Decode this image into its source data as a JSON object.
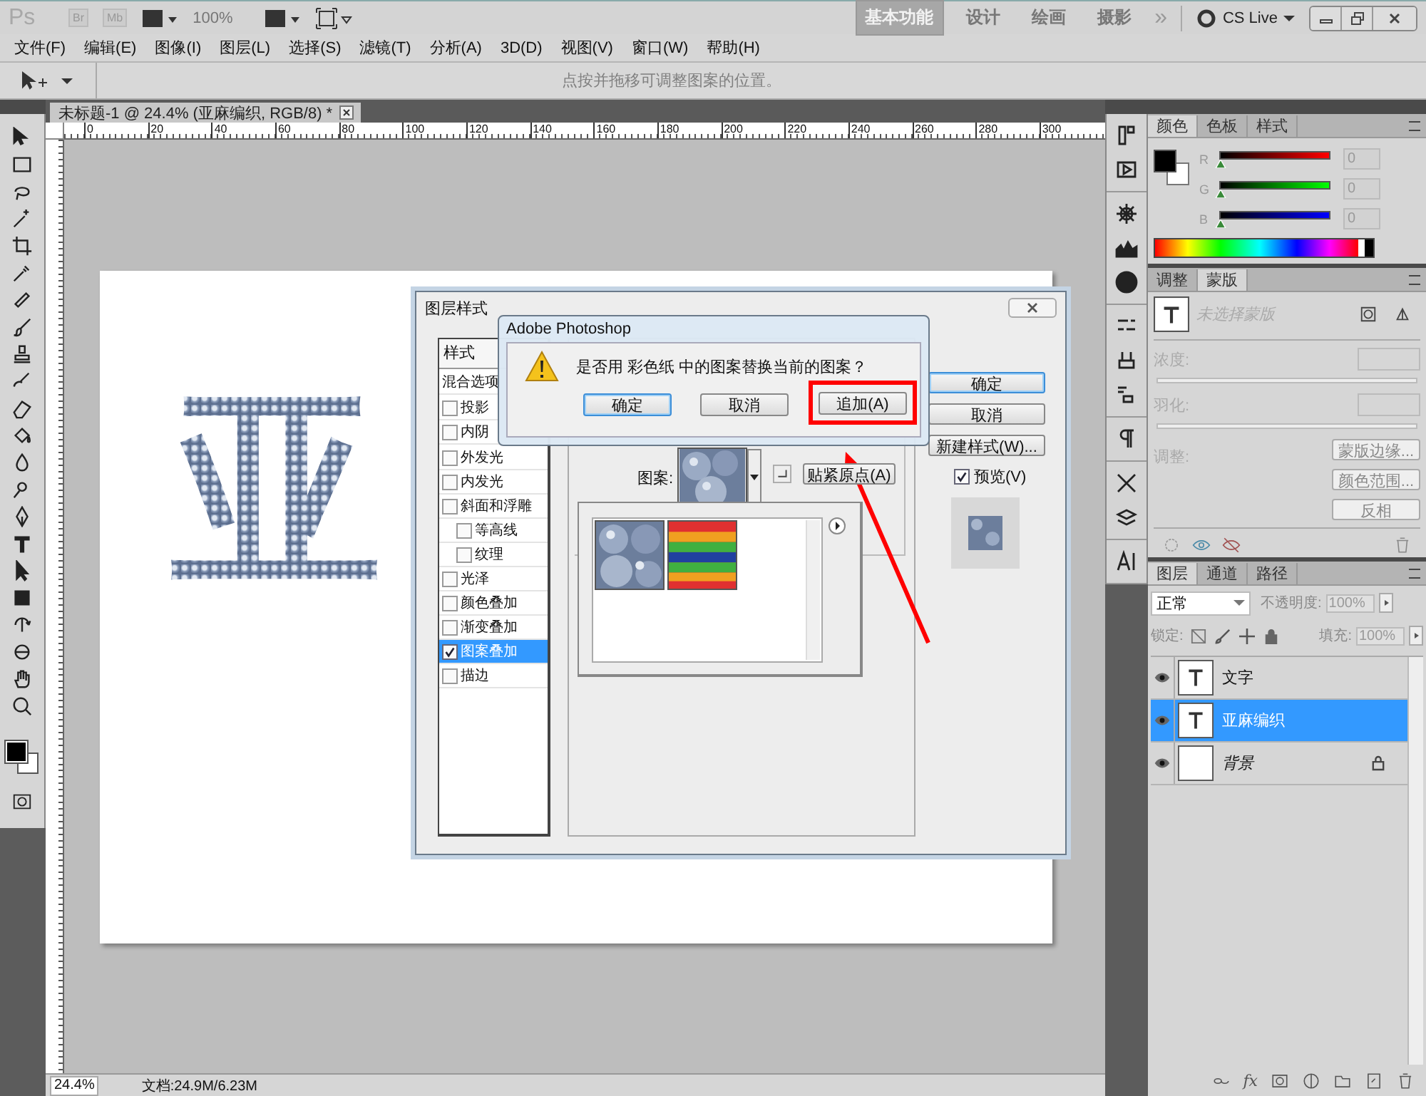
{
  "app_bar": {
    "logo": "Ps",
    "bridge": "Br",
    "mini_bridge": "Mb",
    "zoom": "100%",
    "workspaces": [
      {
        "label": "基本功能",
        "selected": true
      },
      {
        "label": "设计",
        "selected": false
      },
      {
        "label": "绘画",
        "selected": false
      },
      {
        "label": "摄影",
        "selected": false
      }
    ],
    "more": "»",
    "cs_live": "CS Live"
  },
  "menu": [
    "文件(F)",
    "编辑(E)",
    "图像(I)",
    "图层(L)",
    "选择(S)",
    "滤镜(T)",
    "分析(A)",
    "3D(D)",
    "视图(V)",
    "窗口(W)",
    "帮助(H)"
  ],
  "options_bar": {
    "hint": "点按并拖移可调整图案的位置。"
  },
  "document": {
    "tab": "未标题-1 @ 24.4% (亚麻编织, RGB/8) *",
    "ruler": [
      "0",
      "20",
      "40",
      "60",
      "80",
      "100",
      "120",
      "140",
      "160",
      "180",
      "200",
      "220",
      "240",
      "260",
      "280",
      "300"
    ],
    "canvas_text": "亚"
  },
  "status_bar": {
    "zoom": "24.4%",
    "doc_size": "文档:24.9M/6.23M"
  },
  "layer_style": {
    "title": "图层样式",
    "list_header": "样式",
    "blend_options": "混合选项",
    "effects": [
      {
        "label": "投影",
        "checked": false,
        "selected": false
      },
      {
        "label": "内阴",
        "checked": false,
        "selected": false
      },
      {
        "label": "外发光",
        "checked": false,
        "selected": false
      },
      {
        "label": "内发光",
        "checked": false,
        "selected": false
      },
      {
        "label": "斜面和浮雕",
        "checked": false,
        "selected": false,
        "children": [
          {
            "label": "等高线",
            "checked": false,
            "selected": false
          },
          {
            "label": "纹理",
            "checked": false,
            "selected": false
          }
        ]
      },
      {
        "label": "光泽",
        "checked": false,
        "selected": false
      },
      {
        "label": "颜色叠加",
        "checked": false,
        "selected": false
      },
      {
        "label": "渐变叠加",
        "checked": false,
        "selected": false
      },
      {
        "label": "图案叠加",
        "checked": true,
        "selected": true
      },
      {
        "label": "描边",
        "checked": false,
        "selected": false
      }
    ],
    "pattern_label": "图案:",
    "snap_button": "贴紧原点(A)",
    "patterns": [
      {
        "kind": "bubbles"
      },
      {
        "kind": "rainbow"
      }
    ],
    "buttons": [
      {
        "label": "确定",
        "default": true
      },
      {
        "label": "取消",
        "default": false
      },
      {
        "label": "新建样式(W)...",
        "default": false
      }
    ],
    "preview": {
      "label": "预览(V)",
      "checked": true
    }
  },
  "alert": {
    "title": "Adobe Photoshop",
    "message": "是否用 彩色纸 中的图案替换当前的图案？",
    "buttons": [
      {
        "label": "确定",
        "default": true,
        "highlighted": false
      },
      {
        "label": "取消",
        "default": false,
        "highlighted": false
      },
      {
        "label": "追加(A)",
        "default": false,
        "highlighted": true
      }
    ]
  },
  "color_panel": {
    "tabs": [
      {
        "label": "颜色",
        "selected": true
      },
      {
        "label": "色板",
        "selected": false
      },
      {
        "label": "样式",
        "selected": false
      }
    ],
    "channels": [
      {
        "label": "R",
        "value": "0",
        "level": 0
      },
      {
        "label": "G",
        "value": "0",
        "level": 0
      },
      {
        "label": "B",
        "value": "0",
        "level": 0
      }
    ]
  },
  "masks_panel": {
    "tabs": [
      {
        "label": "调整",
        "selected": false
      },
      {
        "label": "蒙版",
        "selected": true
      }
    ],
    "mask_name": "未选择蒙版",
    "density_label": "浓度:",
    "feather_label": "羽化:",
    "refine_label": "调整:",
    "buttons": [
      "蒙版边缘...",
      "颜色范围...",
      "反相"
    ]
  },
  "layers_panel": {
    "tabs": [
      {
        "label": "图层",
        "selected": true
      },
      {
        "label": "通道",
        "selected": false
      },
      {
        "label": "路径",
        "selected": false
      }
    ],
    "blend_mode": "正常",
    "opacity_label": "不透明度:",
    "opacity": "100%",
    "lock_label": "锁定:",
    "fill_label": "填充:",
    "fill": "100%",
    "effects_button": "fx",
    "layers": [
      {
        "name": "文字",
        "kind": "text",
        "visible": true,
        "selected": false,
        "locked": false
      },
      {
        "name": "亚麻编织",
        "kind": "text",
        "visible": true,
        "selected": true,
        "locked": false
      },
      {
        "name": "背景",
        "kind": "image",
        "visible": true,
        "selected": false,
        "locked": true
      }
    ]
  }
}
